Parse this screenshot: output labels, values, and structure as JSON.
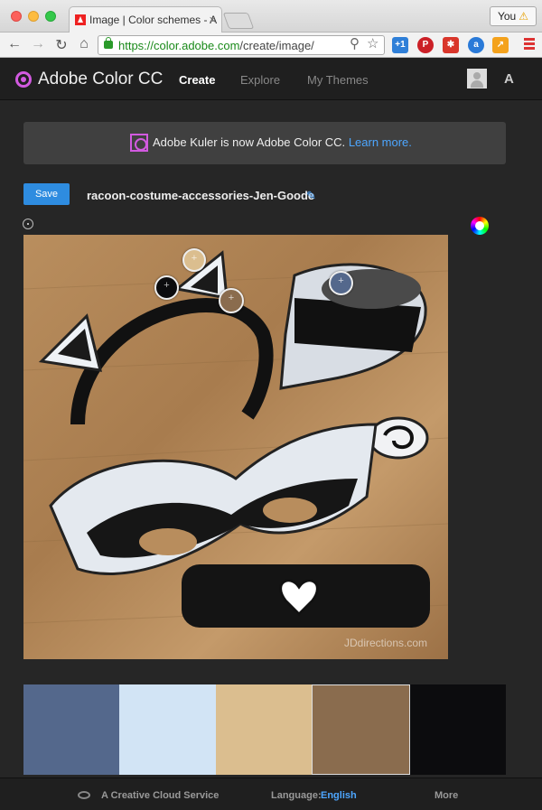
{
  "browser": {
    "tab_title": "Image | Color schemes - A",
    "profile_label": "You",
    "url_host": "https://color.adobe.com",
    "url_path": "/create/image/"
  },
  "app": {
    "title": "Adobe Color CC",
    "nav": [
      {
        "label": "Create",
        "active": true
      },
      {
        "label": "Explore",
        "active": false
      },
      {
        "label": "My Themes",
        "active": false
      }
    ]
  },
  "notice": {
    "text": "Adobe Kuler is now Adobe Color CC.",
    "link": "Learn more."
  },
  "editor": {
    "save_label": "Save",
    "theme_name": "racoon-costume-accessories-Jen-Goode",
    "watermark": "JDdirections.com"
  },
  "swatches": [
    {
      "color": "#54688c",
      "selected": false
    },
    {
      "color": "#d2e4f5",
      "selected": false
    },
    {
      "color": "#dbbe8f",
      "selected": false
    },
    {
      "color": "#8a6c4e",
      "selected": true
    },
    {
      "color": "#0c0c0e",
      "selected": false
    }
  ],
  "footer": {
    "service": "A Creative Cloud Service",
    "language_label": "Language:",
    "language_value": "English",
    "more": "More"
  }
}
